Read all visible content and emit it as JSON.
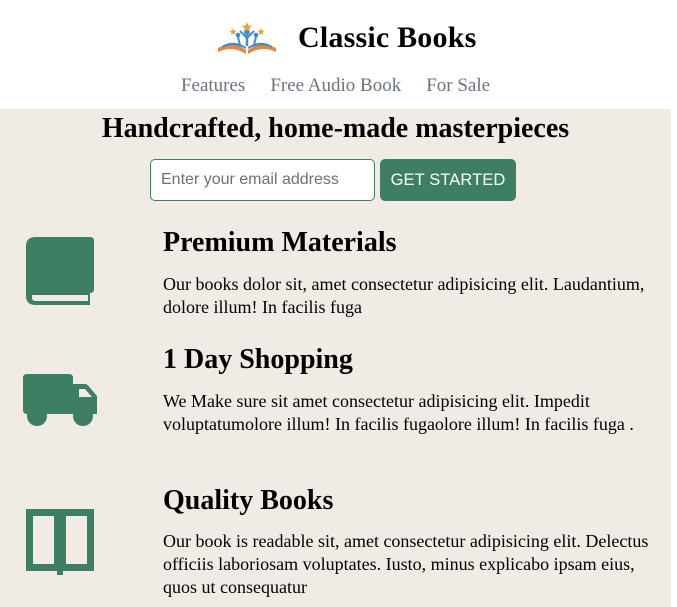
{
  "brand": {
    "title": "Classic Books",
    "logo_icon": "open-book-logo-icon"
  },
  "nav": {
    "items": [
      "Features",
      "Free Audio Book",
      "For Sale"
    ]
  },
  "hero": {
    "title": "Handcrafted, home-made masterpieces"
  },
  "signup": {
    "placeholder": "Enter your email address",
    "button_label": "GET STARTED"
  },
  "features": [
    {
      "icon": "book-icon",
      "title": "Premium Materials",
      "text": "Our books dolor sit, amet consectetur adipisicing elit. Laudantium, dolore illum! In facilis fuga"
    },
    {
      "icon": "truck-icon",
      "title": "1 Day Shopping",
      "text": "We Make sure sit amet consectetur adipisicing elit. Impedit voluptatumolore illum! In facilis fugaolore illum! In facilis fuga ."
    },
    {
      "icon": "open-book-icon",
      "title": "Quality Books",
      "text": "Our book is readable sit, amet consectetur adipisicing elit. Delectus officiis laboriosam voluptates. Iusto, minus explicabo ipsam eius, quos ut consequatur"
    }
  ],
  "colors": {
    "accent": "#3e7e62",
    "background": "#f0ebe4",
    "nav_text": "#6b7280"
  }
}
